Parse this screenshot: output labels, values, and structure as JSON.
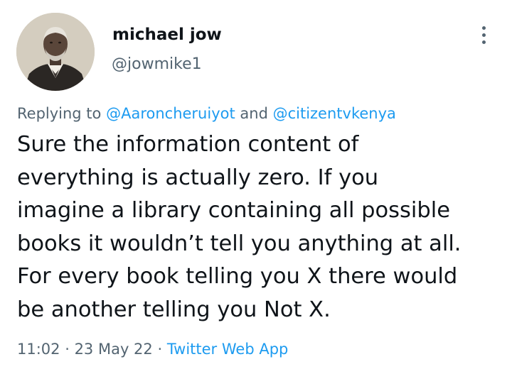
{
  "author": {
    "display_name": "michael jow",
    "handle": "@jowmike1",
    "avatar": "portrait-photo"
  },
  "more_icon": "more-vertical-icon",
  "reply_context": {
    "prefix": "Replying to ",
    "mention_1": "@Aaroncheruiyot",
    "conjunction": " and ",
    "mention_2": "@citizentvkenya"
  },
  "tweet": {
    "lines": [
      "Sure the information content of",
      "everything is actually zero. If you",
      "imagine a library containing all possible",
      "books it wouldn’t tell you anything at all.",
      "For every book telling you X there would",
      "be another telling you Not X."
    ]
  },
  "meta": {
    "time": "11:02",
    "separator_1": " · ",
    "date": "23 May 22",
    "separator_2": " · ",
    "source": "Twitter Web App"
  },
  "colors": {
    "text": "#0f1419",
    "secondary": "#536471",
    "link": "#1d9bf0"
  }
}
